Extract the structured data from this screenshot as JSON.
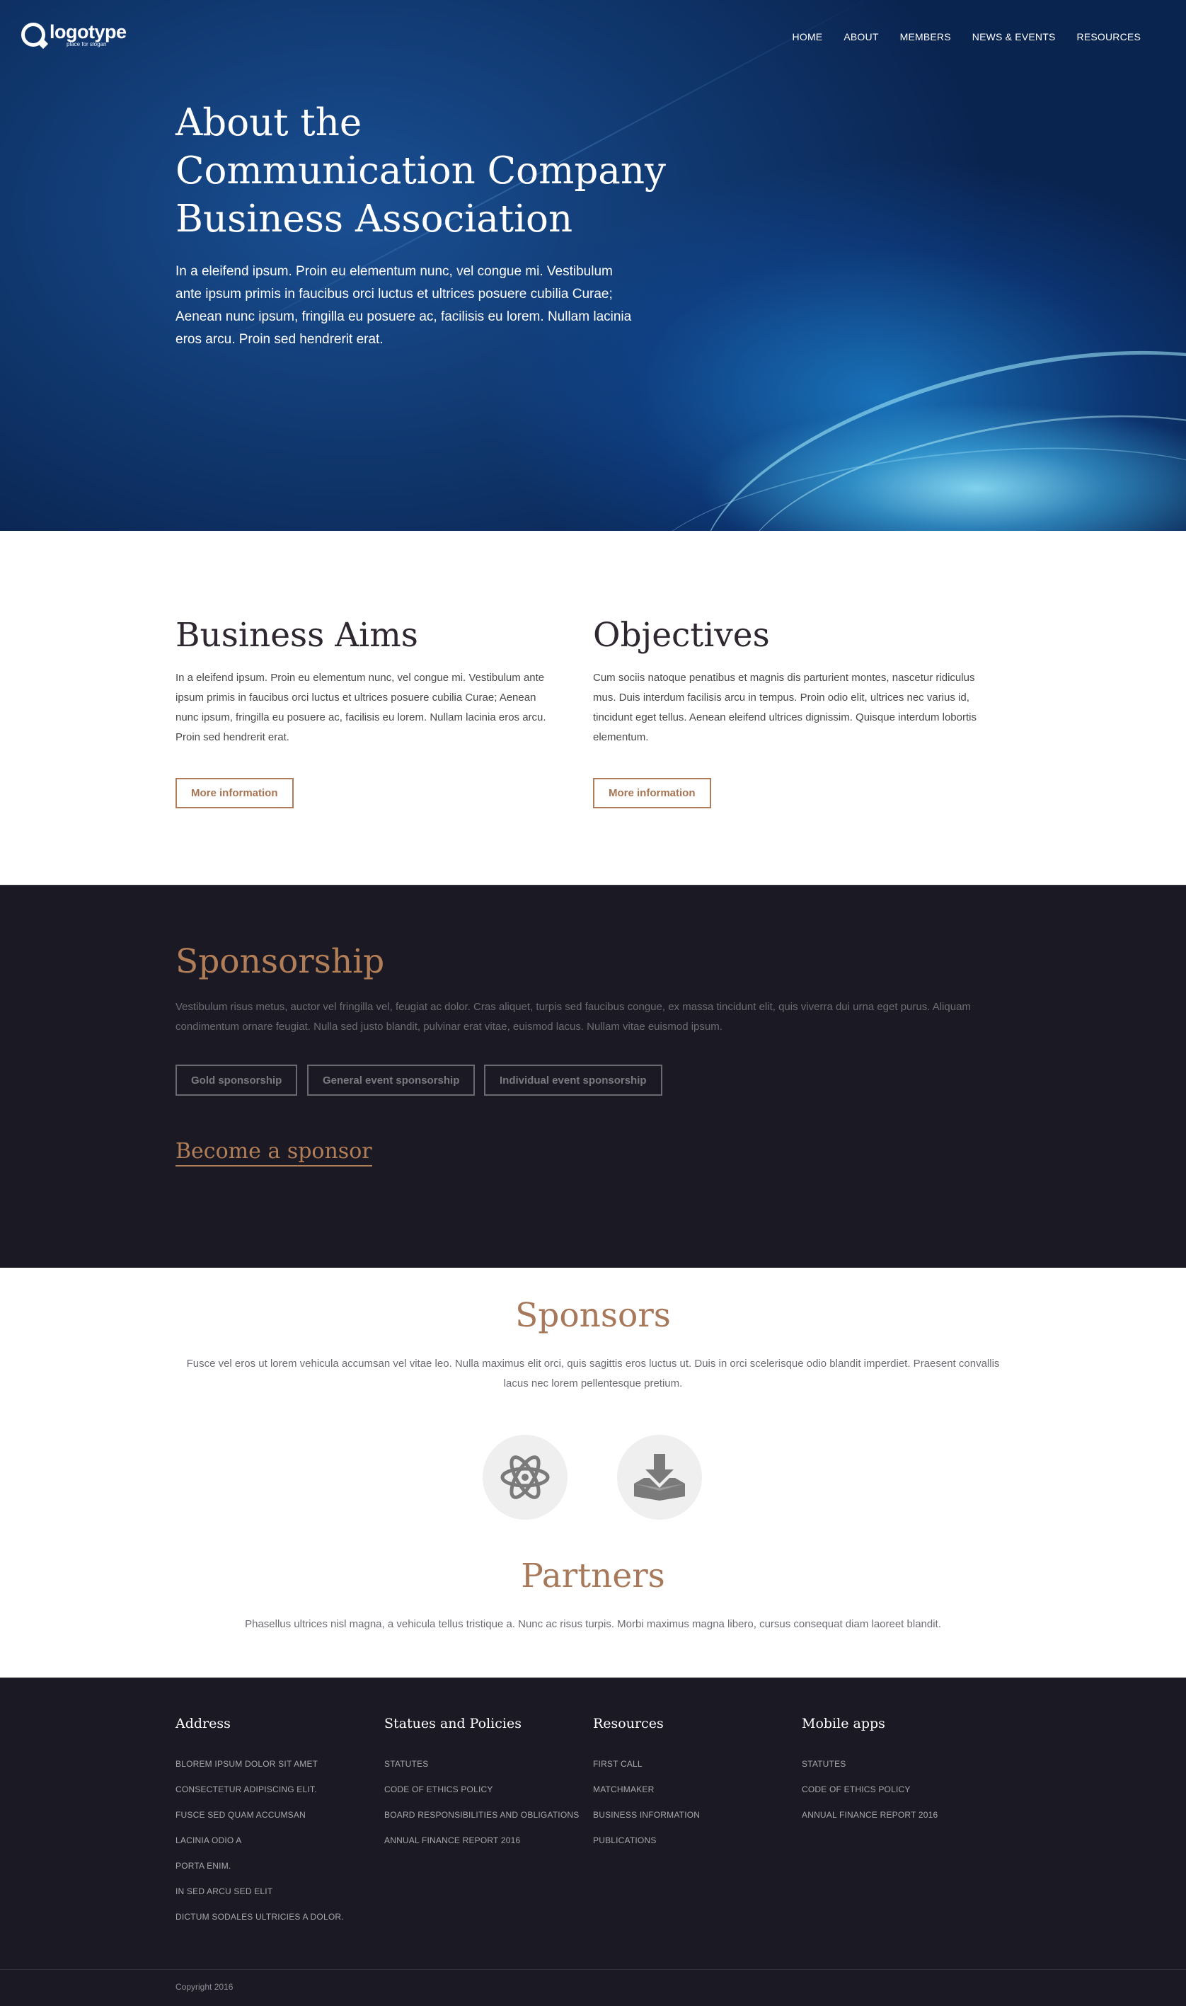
{
  "brand": {
    "logo_word": "logotype",
    "logo_slogan": "place for slogan"
  },
  "nav": {
    "items": [
      "HOME",
      "ABOUT",
      "MEMBERS",
      "NEWS & EVENTS",
      "RESOURCES"
    ]
  },
  "hero": {
    "title_lines": [
      "About the",
      "Communication Company",
      "Business Association"
    ],
    "text": "In a eleifend ipsum. Proin eu elementum nunc, vel congue mi. Vestibulum ante ipsum primis in faucibus orci luctus et ultrices posuere cubilia Curae; Aenean nunc ipsum, fringilla eu posuere ac, facilisis eu lorem. Nullam lacinia eros arcu. Proin sed hendrerit erat."
  },
  "aims": {
    "left": {
      "title": "Business Aims",
      "text": "In a eleifend ipsum. Proin eu elementum nunc, vel congue mi. Vestibulum ante ipsum primis in faucibus orci luctus et ultrices posuere cubilia Curae; Aenean nunc ipsum, fringilla eu posuere ac, facilisis eu lorem. Nullam lacinia eros arcu. Proin sed hendrerit erat.",
      "button": "More information"
    },
    "right": {
      "title": "Objectives",
      "text": "Cum sociis natoque penatibus et magnis dis parturient montes, nascetur ridiculus mus. Duis interdum facilisis arcu in tempus. Proin odio elit, ultrices nec varius id, tincidunt eget tellus. Aenean eleifend ultrices dignissim. Quisque interdum lobortis elementum.",
      "button": "More information"
    }
  },
  "sponsorship": {
    "title": "Sponsorship",
    "text": "Vestibulum risus metus, auctor vel fringilla vel, feugiat ac dolor. Cras aliquet, turpis sed faucibus congue, ex massa tincidunt elit, quis viverra dui urna eget purus. Aliquam condimentum ornare feugiat. Nulla sed justo blandit, pulvinar erat vitae, euismod lacus. Nullam vitae euismod ipsum.",
    "buttons": [
      "Gold sponsorship",
      "General event sponsorship",
      "Individual event sponsorship"
    ],
    "become_link": "Become a sponsor"
  },
  "sponsors": {
    "title": "Sponsors",
    "text": "Fusce vel eros ut lorem vehicula accumsan vel vitae leo. Nulla maximus elit orci, quis sagittis eros luctus ut. Duis in orci scelerisque odio blandit imperdiet. Praesent convallis lacus nec lorem pellentesque pretium.",
    "icons": [
      "atom-icon",
      "download-tray-icon"
    ]
  },
  "partners": {
    "title": "Partners",
    "text": "Phasellus ultrices nisl magna, a vehicula tellus tristique a. Nunc ac risus turpis. Morbi maximus magna libero, cursus consequat diam laoreet blandit."
  },
  "footer": {
    "columns": [
      {
        "title": "Address",
        "items": [
          "BLOREM IPSUM DOLOR SIT AMET",
          "CONSECTETUR ADIPISCING ELIT.",
          "FUSCE SED QUAM ACCUMSAN",
          "LACINIA ODIO A",
          "PORTA ENIM.",
          "IN SED ARCU SED ELIT",
          "DICTUM SODALES ULTRICIES A DOLOR."
        ]
      },
      {
        "title": "Statues and Policies",
        "items": [
          "STATUTES",
          "CODE OF ETHICS POLICY",
          "BOARD RESPONSIBILITIES AND OBLIGATIONS",
          "ANNUAL FINANCE REPORT 2016"
        ]
      },
      {
        "title": "Resources",
        "items": [
          "FIRST CALL",
          "MATCHMAKER",
          "BUSINESS INFORMATION",
          "PUBLICATIONS"
        ]
      },
      {
        "title": "Mobile apps",
        "items": [
          "STATUTES",
          "CODE OF ETHICS POLICY",
          "ANNUAL FINANCE REPORT 2016"
        ]
      }
    ],
    "copyright": "Copyright 2016"
  },
  "colors": {
    "accent_brown": "#b27e58",
    "dark_bg": "#1b1a24",
    "hero_blue": "#10386f"
  }
}
